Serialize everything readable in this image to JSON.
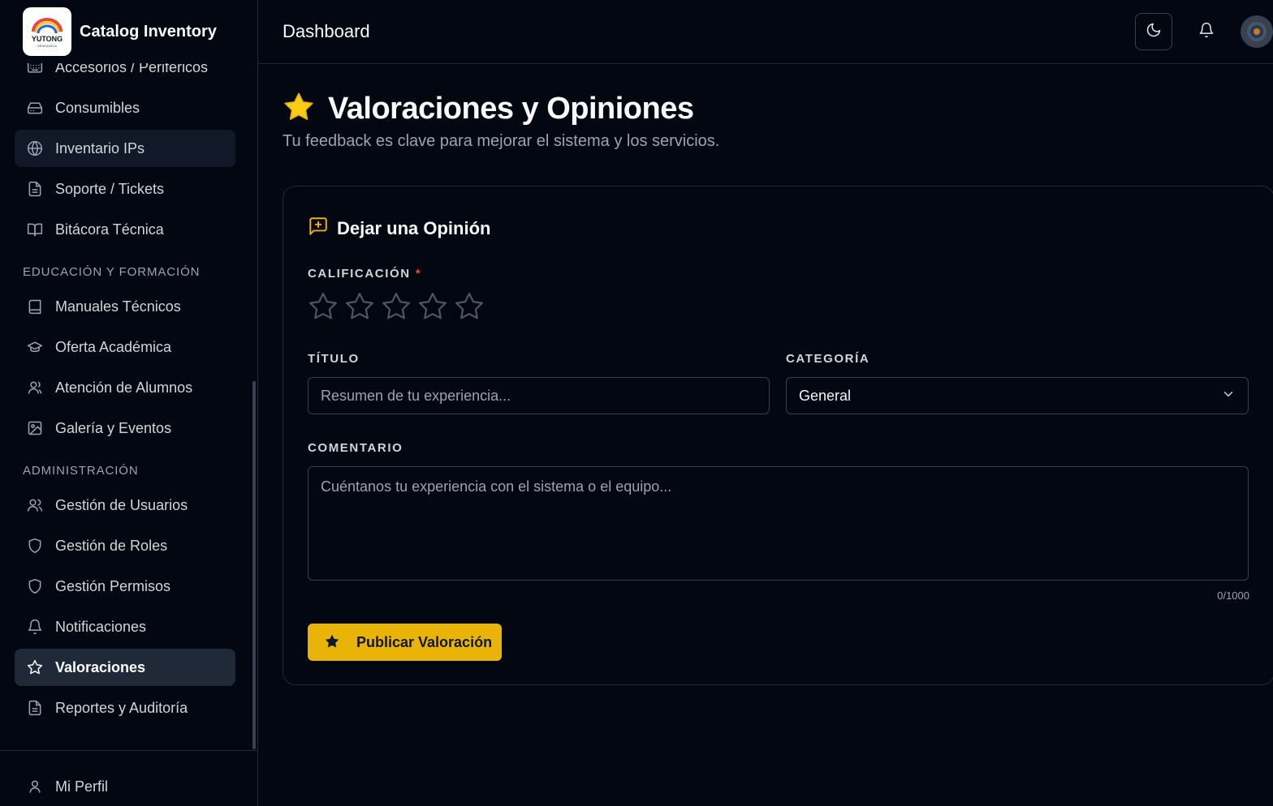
{
  "app": {
    "brand_name": "Catalog Inventory",
    "logo_text": "YUTONG",
    "logo_subtext": "VENEZUELA"
  },
  "sidebar": {
    "items": [
      {
        "label": "Accesorios / Periféricos",
        "icon": "keyboard-icon"
      },
      {
        "label": "Consumibles",
        "icon": "hard-drive-icon"
      },
      {
        "label": "Inventario IPs",
        "icon": "globe-icon"
      },
      {
        "label": "Soporte / Tickets",
        "icon": "file-text-icon"
      },
      {
        "label": "Bitácora Técnica",
        "icon": "book-open-icon"
      }
    ],
    "section_education": "EDUCACIÓN Y FORMACIÓN",
    "education_items": [
      {
        "label": "Manuales Técnicos",
        "icon": "book-icon"
      },
      {
        "label": "Oferta Académica",
        "icon": "graduation-cap-icon"
      },
      {
        "label": "Atención de Alumnos",
        "icon": "user-icon"
      },
      {
        "label": "Galería y Eventos",
        "icon": "image-icon"
      }
    ],
    "section_admin": "ADMINISTRACIÓN",
    "admin_items": [
      {
        "label": "Gestión de Usuarios",
        "icon": "users-icon"
      },
      {
        "label": "Gestión de Roles",
        "icon": "shield-icon"
      },
      {
        "label": "Gestión Permisos",
        "icon": "shield-icon"
      },
      {
        "label": "Notificaciones",
        "icon": "bell-icon"
      },
      {
        "label": "Valoraciones",
        "icon": "star-icon"
      },
      {
        "label": "Reportes y Auditoría",
        "icon": "file-text-icon"
      }
    ],
    "profile_label": "Mi Perfil"
  },
  "header": {
    "title": "Dashboard"
  },
  "page": {
    "title": "Valoraciones y Opiniones",
    "subtitle": "Tu feedback es clave para mejorar el sistema y los servicios."
  },
  "form": {
    "card_title": "Dejar una Opinión",
    "rating_label": "CALIFICACIÓN",
    "required_mark": "*",
    "rating_value": 0,
    "rating_max": 5,
    "title_label": "TÍTULO",
    "title_placeholder": "Resumen de tu experiencia...",
    "category_label": "CATEGORÍA",
    "category_value": "General",
    "comment_label": "COMENTARIO",
    "comment_placeholder": "Cuéntanos tu experiencia con el sistema o el equipo...",
    "char_counter": "0/1000",
    "submit_label": "Publicar Valoración"
  },
  "colors": {
    "accent": "#eab308",
    "background": "#030712",
    "border": "#1f2937",
    "required": "#ef4444"
  }
}
